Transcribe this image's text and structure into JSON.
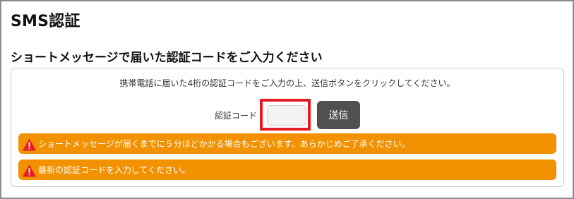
{
  "page": {
    "title": "SMS認証"
  },
  "section": {
    "title": "ショートメッセージで届いた認証コードをご入力ください"
  },
  "form": {
    "instruction": "携帯電話に届いた4桁の認証コードをご入力の上、送信ボタンをクリックしてください。",
    "code_label": "認証コード",
    "code_value": "",
    "code_placeholder": "",
    "submit_label": "送信"
  },
  "alerts": [
    {
      "icon": "warning-icon",
      "text": "ショートメッセージが届くまでに５分ほどかかる場合もございます。あらかじめご了承ください。"
    },
    {
      "icon": "warning-icon",
      "text": "最新の認証コードを入力してください。"
    }
  ],
  "colors": {
    "alert_background": "#f39200",
    "highlight_border": "#e31b23",
    "button_background": "#505050",
    "warning_icon": "#e31b23"
  }
}
